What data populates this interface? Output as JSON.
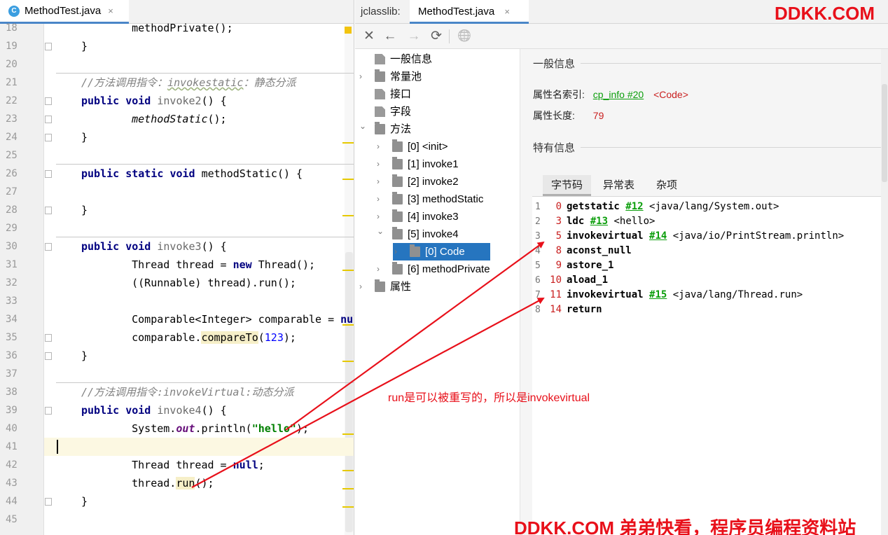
{
  "editor": {
    "tab_label": "MethodTest.java",
    "tab_close": "×",
    "tab_icon_letter": "C",
    "current_line": "41",
    "lines": [
      {
        "n": "18",
        "segments": [
          {
            "t": "    methodPrivate();",
            "c": ""
          }
        ]
      },
      {
        "n": "19",
        "segments": [
          {
            "t": "}",
            "c": ""
          }
        ]
      },
      {
        "n": "20",
        "segments": []
      },
      {
        "n": "21",
        "segments": [
          {
            "t": "//方法调用指令：",
            "c": "cm"
          },
          {
            "t": "invokestatic",
            "c": "cm wavy"
          },
          {
            "t": "：静态分派",
            "c": "cm"
          }
        ]
      },
      {
        "n": "22",
        "segments": [
          {
            "t": "public ",
            "c": "kw"
          },
          {
            "t": "void ",
            "c": "kw"
          },
          {
            "t": "invoke2",
            "c": "gray"
          },
          {
            "t": "() {",
            "c": ""
          }
        ]
      },
      {
        "n": "23",
        "segments": [
          {
            "t": "    ",
            "c": ""
          },
          {
            "t": "methodStatic",
            "c": "it"
          },
          {
            "t": "();",
            "c": ""
          }
        ]
      },
      {
        "n": "24",
        "segments": [
          {
            "t": "}",
            "c": ""
          }
        ]
      },
      {
        "n": "25",
        "segments": []
      },
      {
        "n": "26",
        "segments": [
          {
            "t": "public ",
            "c": "kw"
          },
          {
            "t": "static ",
            "c": "kw"
          },
          {
            "t": "void ",
            "c": "kw"
          },
          {
            "t": "methodStatic() {",
            "c": ""
          }
        ]
      },
      {
        "n": "27",
        "segments": []
      },
      {
        "n": "28",
        "segments": [
          {
            "t": "}",
            "c": ""
          }
        ]
      },
      {
        "n": "29",
        "segments": []
      },
      {
        "n": "30",
        "segments": [
          {
            "t": "public ",
            "c": "kw"
          },
          {
            "t": "void ",
            "c": "kw"
          },
          {
            "t": "invoke3",
            "c": "gray"
          },
          {
            "t": "() {",
            "c": ""
          }
        ]
      },
      {
        "n": "31",
        "segments": [
          {
            "t": "    Thread thread = ",
            "c": ""
          },
          {
            "t": "new ",
            "c": "kw"
          },
          {
            "t": "Thread();",
            "c": ""
          }
        ]
      },
      {
        "n": "32",
        "segments": [
          {
            "t": "    ((Runnable) thread).run();",
            "c": ""
          }
        ]
      },
      {
        "n": "33",
        "segments": []
      },
      {
        "n": "34",
        "segments": [
          {
            "t": "    Comparable<Integer> comparable = ",
            "c": ""
          },
          {
            "t": "null",
            "c": "kw"
          },
          {
            "t": ";",
            "c": ""
          }
        ]
      },
      {
        "n": "35",
        "segments": [
          {
            "t": "    comparable.",
            "c": ""
          },
          {
            "t": "compareTo",
            "c": "hl"
          },
          {
            "t": "(",
            "c": ""
          },
          {
            "t": "123",
            "c": "num"
          },
          {
            "t": ");",
            "c": ""
          }
        ]
      },
      {
        "n": "36",
        "segments": [
          {
            "t": "}",
            "c": ""
          }
        ]
      },
      {
        "n": "37",
        "segments": []
      },
      {
        "n": "38",
        "segments": [
          {
            "t": "//方法调用指令:invokeVirtual:动态分派",
            "c": "cm"
          }
        ]
      },
      {
        "n": "39",
        "segments": [
          {
            "t": "public ",
            "c": "kw"
          },
          {
            "t": "void ",
            "c": "kw"
          },
          {
            "t": "invoke4",
            "c": "gray"
          },
          {
            "t": "() {",
            "c": ""
          }
        ]
      },
      {
        "n": "40",
        "segments": [
          {
            "t": "    System.",
            "c": ""
          },
          {
            "t": "out",
            "c": "fld"
          },
          {
            "t": ".println(",
            "c": ""
          },
          {
            "t": "\"hello\"",
            "c": "str"
          },
          {
            "t": ");",
            "c": ""
          }
        ]
      },
      {
        "n": "41",
        "segments": []
      },
      {
        "n": "42",
        "segments": [
          {
            "t": "    Thread thread = ",
            "c": ""
          },
          {
            "t": "null",
            "c": "kw"
          },
          {
            "t": ";",
            "c": ""
          }
        ]
      },
      {
        "n": "43",
        "segments": [
          {
            "t": "    thread.",
            "c": ""
          },
          {
            "t": "run",
            "c": "hl"
          },
          {
            "t": "();",
            "c": ""
          }
        ]
      },
      {
        "n": "44",
        "segments": [
          {
            "t": "}",
            "c": ""
          }
        ]
      },
      {
        "n": "45",
        "segments": []
      }
    ]
  },
  "jclasslib": {
    "label": "jclasslib:",
    "tab_label": "MethodTest.java",
    "tab_close": "×",
    "toolbar": {
      "close": "✕",
      "back": "←",
      "forward": "→",
      "refresh": "⟳",
      "web": "🌐"
    },
    "tree": [
      {
        "label": "一般信息",
        "icon": "doc",
        "arrow": ""
      },
      {
        "label": "常量池",
        "icon": "folder",
        "arrow": "›"
      },
      {
        "label": "接口",
        "icon": "doc",
        "arrow": ""
      },
      {
        "label": "字段",
        "icon": "doc",
        "arrow": ""
      },
      {
        "label": "方法",
        "icon": "folder",
        "arrow": "⌄"
      },
      {
        "label": "[0] <init>",
        "icon": "folder",
        "arrow": "›"
      },
      {
        "label": "[1] invoke1",
        "icon": "folder",
        "arrow": "›"
      },
      {
        "label": "[2] invoke2",
        "icon": "folder",
        "arrow": "›"
      },
      {
        "label": "[3] methodStatic",
        "icon": "folder",
        "arrow": "›"
      },
      {
        "label": "[4] invoke3",
        "icon": "folder",
        "arrow": "›"
      },
      {
        "label": "[5] invoke4",
        "icon": "folder",
        "arrow": "⌄"
      },
      {
        "label": "[0] Code",
        "icon": "folder",
        "arrow": "›"
      },
      {
        "label": "[6] methodPrivate",
        "icon": "folder",
        "arrow": "›"
      },
      {
        "label": "属性",
        "icon": "folder",
        "arrow": "›"
      }
    ],
    "selected_tree_item": "[0] Code",
    "general_section": "一般信息",
    "attr_name_index_label": "属性名索引:",
    "attr_name_index_link": "cp_info #20",
    "attr_name_index_value": "<Code>",
    "attr_length_label": "属性长度:",
    "attr_length_value": "79",
    "specific_section": "特有信息",
    "inner_tabs": [
      "字节码",
      "异常表",
      "杂项"
    ],
    "active_inner_tab": "字节码",
    "bytecode": [
      {
        "line": "1",
        "offset": "0",
        "op": "getstatic",
        "ref": "#12",
        "comment": "<java/lang/System.out>"
      },
      {
        "line": "2",
        "offset": "3",
        "op": "ldc",
        "ref": "#13",
        "comment": "<hello>"
      },
      {
        "line": "3",
        "offset": "5",
        "op": "invokevirtual",
        "ref": "#14",
        "comment": "<java/io/PrintStream.println>"
      },
      {
        "line": "4",
        "offset": "8",
        "op": "aconst_null",
        "ref": "",
        "comment": ""
      },
      {
        "line": "5",
        "offset": "9",
        "op": "astore_1",
        "ref": "",
        "comment": ""
      },
      {
        "line": "6",
        "offset": "10",
        "op": "aload_1",
        "ref": "",
        "comment": ""
      },
      {
        "line": "7",
        "offset": "11",
        "op": "invokevirtual",
        "ref": "#15",
        "comment": "<java/lang/Thread.run>"
      },
      {
        "line": "8",
        "offset": "14",
        "op": "return",
        "ref": "",
        "comment": ""
      }
    ]
  },
  "overlay": {
    "annotation": "run是可以被重写的，所以是invokevirtual",
    "watermark_top": "DDKK.COM",
    "watermark_bottom": "DDKK.COM 弟弟快看，程序员编程资料站",
    "accent_color": "#e8101a"
  }
}
